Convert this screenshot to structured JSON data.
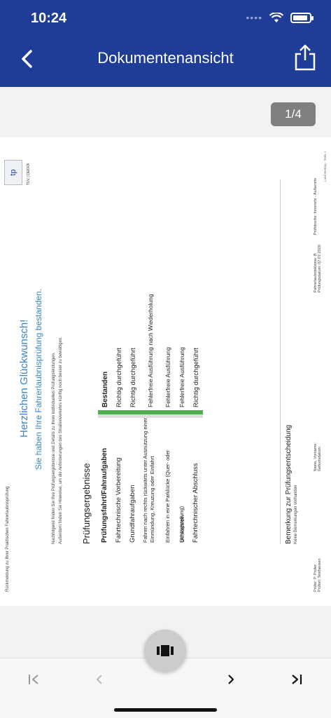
{
  "status_bar": {
    "time": "10:24"
  },
  "header": {
    "title": "Dokumentenansicht"
  },
  "viewer": {
    "page_indicator": "1/4"
  },
  "document": {
    "top_small_text": "Rückmeldung zu Ihrer Praktischen Fahrerlaubnisprüfung",
    "logo_text": "tp",
    "logo_caption": "TÜV | DEKRA",
    "headline": "Herzlichen Glückwunsch!",
    "subheadline": "Sie haben Ihre Fahrerlaubnisprüfung bestanden.",
    "intro_line1": "Nachfolgend finden Sie Ihre Prüfungsergebnisse und Details zu Ihren individuellen Prüfungsleistungen.",
    "intro_line2": "Außerdem finden Sie Hinweise, um die Anforderungen des Straßenverkehrs künftig noch besser zu bewältigen.",
    "section_title": "Prüfungsergebnisse",
    "table_header": {
      "task": "Prüfungsfahrt/Fahraufgaben",
      "result": "Bestanden"
    },
    "rows": [
      {
        "task": "Fahrtechnische Vorbereitung",
        "result": "Richtig durchgeführt"
      },
      {
        "task": "Grundfahraufgaben",
        "result": "Richtig durchgeführt"
      },
      {
        "task": "Fahren nach rechts rückwärts unter Ausnutzung einer Einmündung, Kreuzung oder Einfahrt",
        "result": "Fehlerfreie Ausführung nach Wiederholung"
      },
      {
        "task": "Einfahren in eine Parklücke (Quer- oder Schrägstellung)",
        "result": "Fehlerfreie Ausführung"
      },
      {
        "task": "Umkehren",
        "result": "Fehlerfreie Ausführung"
      },
      {
        "task": "Fahrtechnischer Abschluss",
        "result": "Richtig durchgeführt"
      }
    ],
    "remark_title": "Bemerkung zur Prüfungsentscheidung",
    "remark_text": "Keine Bemerkungen vorhanden",
    "footer": {
      "pruefer_label": "Prüfer:",
      "pruefer_value": "P. Prüfer",
      "pruefort_label": "Prüfort:",
      "pruefort_value": "Testhausen",
      "name_label": "Name, Vorname:",
      "geburtsdatum_label": "Geburtsdatum:",
      "klasse_label": "Fahrerlaubnisklasse:",
      "klasse_value": "B",
      "datum_label": "Prüfungsdatum:",
      "datum_value": "07.07.2020",
      "strecke_label": "Prüfstrecke:",
      "strecke_value": "Innerorts - Außerorts",
      "page_note": "Land Beitrag - Seite 1"
    },
    "accent_color": "#3a86c8",
    "pass_color": "#4caf50"
  },
  "bottom_bar": {
    "first_icon": "first-page-icon",
    "prev_icon": "previous-page-icon",
    "next_icon": "next-page-icon",
    "last_icon": "last-page-icon",
    "fab_icon": "page-view-icon"
  }
}
